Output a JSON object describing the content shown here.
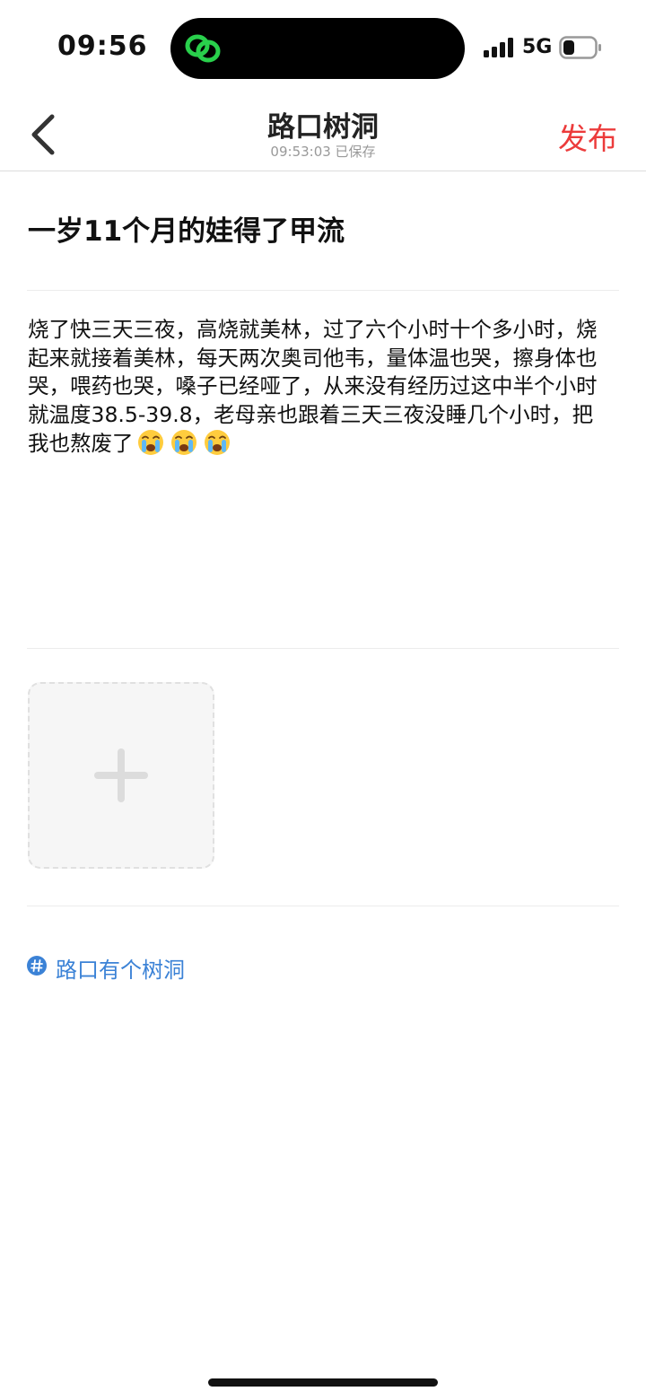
{
  "status_bar": {
    "time": "09:56",
    "network": "5G",
    "island_app_icon": "link-icon",
    "colors": {
      "island_icon": "#29d04c"
    }
  },
  "header": {
    "title": "路口树洞",
    "subtitle": "09:53:03 已保存",
    "back_icon": "chevron-left-icon",
    "publish_label": "发布",
    "colors": {
      "publish": "#ec3b3b"
    }
  },
  "post": {
    "title": "一岁11个月的娃得了甲流",
    "body": "烧了快三天三夜，高烧就美林，过了六个小时十个多小时，烧起来就接着美林，每天两次奥司他韦，量体温也哭，擦身体也哭，喂药也哭，嗓子已经哑了，从来没有经历过这中半个小时就温度38.5-39.8，老母亲也跟着三天三夜没睡几个小时，把我也熬废了",
    "emojis": [
      "loudly-crying-face-icon",
      "loudly-crying-face-icon",
      "loudly-crying-face-icon"
    ]
  },
  "media": {
    "add_icon": "plus-icon"
  },
  "topic": {
    "icon": "hash-icon",
    "label": "路口有个树洞",
    "colors": {
      "topic": "#3b82d6"
    }
  }
}
